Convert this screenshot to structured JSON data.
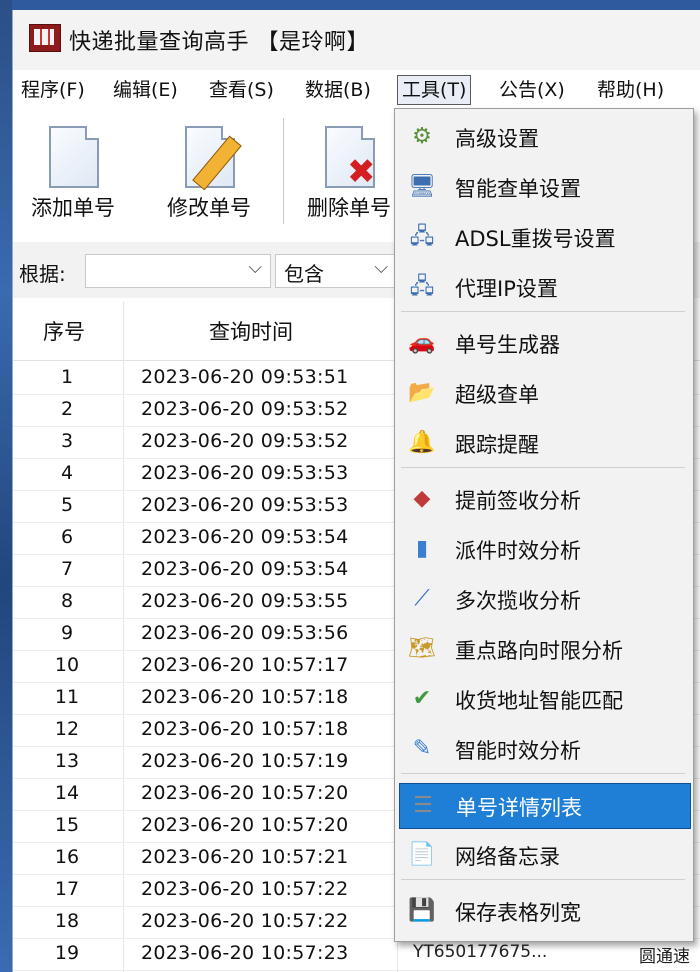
{
  "window": {
    "title": "快递批量查询高手 【是玲啊】"
  },
  "menubar": [
    {
      "label": "程序(F)"
    },
    {
      "label": "编辑(E)"
    },
    {
      "label": "查看(S)"
    },
    {
      "label": "数据(B)"
    },
    {
      "label": "工具(T)"
    },
    {
      "label": "公告(X)"
    },
    {
      "label": "帮助(H)"
    }
  ],
  "toolbar": {
    "add_label": "添加单号",
    "edit_label": "修改单号",
    "delete_label": "删除单号"
  },
  "filter": {
    "label": "根据:",
    "field_value": "",
    "op_value": "包含"
  },
  "grid": {
    "headers": {
      "no": "序号",
      "time": "查询时间"
    },
    "rows": [
      {
        "no": "1",
        "time": "2023-06-20 09:53:51"
      },
      {
        "no": "2",
        "time": "2023-06-20 09:53:52"
      },
      {
        "no": "3",
        "time": "2023-06-20 09:53:52"
      },
      {
        "no": "4",
        "time": "2023-06-20 09:53:53"
      },
      {
        "no": "5",
        "time": "2023-06-20 09:53:53"
      },
      {
        "no": "6",
        "time": "2023-06-20 09:53:54"
      },
      {
        "no": "7",
        "time": "2023-06-20 09:53:54"
      },
      {
        "no": "8",
        "time": "2023-06-20 09:53:55"
      },
      {
        "no": "9",
        "time": "2023-06-20 09:53:56"
      },
      {
        "no": "10",
        "time": "2023-06-20 10:57:17"
      },
      {
        "no": "11",
        "time": "2023-06-20 10:57:18"
      },
      {
        "no": "12",
        "time": "2023-06-20 10:57:18"
      },
      {
        "no": "13",
        "time": "2023-06-20 10:57:19"
      },
      {
        "no": "14",
        "time": "2023-06-20 10:57:20"
      },
      {
        "no": "15",
        "time": "2023-06-20 10:57:20"
      },
      {
        "no": "16",
        "time": "2023-06-20 10:57:21"
      },
      {
        "no": "17",
        "time": "2023-06-20 10:57:22"
      },
      {
        "no": "18",
        "time": "2023-06-20 10:57:22"
      },
      {
        "no": "19",
        "time": "2023-06-20 10:57:23",
        "id": "YT650177675...",
        "extra": "圆通速"
      }
    ]
  },
  "tools_menu": {
    "items": [
      {
        "label": "高级设置",
        "icon": "gear-icon",
        "glyph": "⚙"
      },
      {
        "label": "智能查单设置",
        "icon": "monitor-icon",
        "glyph": "🖥"
      },
      {
        "label": "ADSL重拨号设置",
        "icon": "network-icon",
        "glyph": "🖧"
      },
      {
        "label": "代理IP设置",
        "icon": "network-icon",
        "glyph": "🖧"
      },
      {
        "label": "单号生成器",
        "icon": "car-icon",
        "glyph": "🚗"
      },
      {
        "label": "超级查单",
        "icon": "folder-icon",
        "glyph": "📂"
      },
      {
        "label": "跟踪提醒",
        "icon": "bell-icon",
        "glyph": "🔔"
      },
      {
        "label": "提前签收分析",
        "icon": "cubes-icon",
        "glyph": "◆"
      },
      {
        "label": "派件时效分析",
        "icon": "bar-chart-icon",
        "glyph": "▮"
      },
      {
        "label": "多次揽收分析",
        "icon": "line-chart-icon",
        "glyph": "⟋"
      },
      {
        "label": "重点路向时限分析",
        "icon": "map-icon",
        "glyph": "🗺"
      },
      {
        "label": "收货地址智能匹配",
        "icon": "chart-check-icon",
        "glyph": "✔"
      },
      {
        "label": "智能时效分析",
        "icon": "pencil-chart-icon",
        "glyph": "✎"
      },
      {
        "label": "单号详情列表",
        "icon": "list-icon",
        "glyph": "☰"
      },
      {
        "label": "网络备忘录",
        "icon": "notes-icon",
        "glyph": "📄"
      },
      {
        "label": "保存表格列宽",
        "icon": "save-icon",
        "glyph": "💾"
      }
    ],
    "selected_index": 13
  },
  "colors": {
    "selection": "#1f7fd6",
    "desktop": "#1e3c6e"
  }
}
